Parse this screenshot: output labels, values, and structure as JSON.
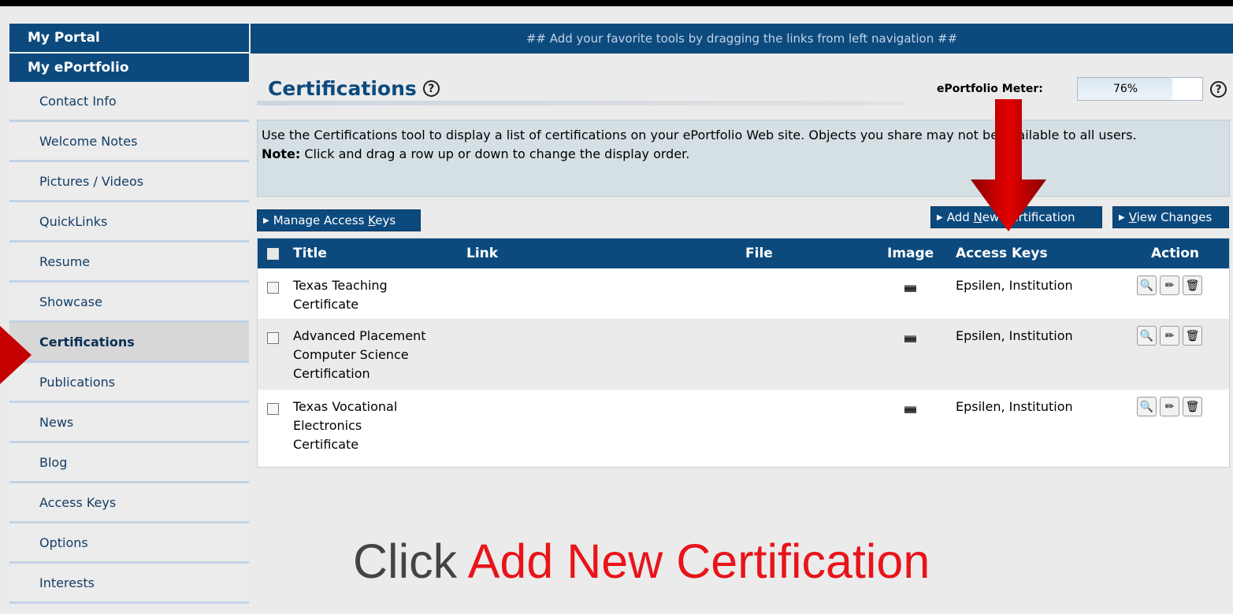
{
  "banner": "## Add your favorite tools by dragging the links from left navigation ##",
  "sidebar": {
    "portal": "My Portal",
    "eportfolio": "My ePortfolio",
    "items": [
      {
        "label": "Contact Info"
      },
      {
        "label": "Welcome Notes"
      },
      {
        "label": "Pictures / Videos"
      },
      {
        "label": "QuickLinks"
      },
      {
        "label": "Resume"
      },
      {
        "label": "Showcase"
      },
      {
        "label": "Certifications",
        "active": true
      },
      {
        "label": "Publications"
      },
      {
        "label": "News"
      },
      {
        "label": "Blog"
      },
      {
        "label": "Access Keys"
      },
      {
        "label": "Options"
      },
      {
        "label": "Interests"
      }
    ]
  },
  "page": {
    "title": "Certifications",
    "help_symbol": "?",
    "meter_label": "ePortfolio Meter:",
    "meter_value": "76%",
    "meter_fraction": 0.76
  },
  "info": {
    "line1": "Use the Certifications tool to display a list of certifications on your ePortfolio Web site. Objects you share may not be available to all users.",
    "note_label": "Note:",
    "note_text": " Click and drag a row up or down to change the display order."
  },
  "buttons": {
    "manage_prefix": "Manage Access ",
    "manage_key": "K",
    "manage_suffix": "eys",
    "add_prefix": "Add ",
    "add_key": "N",
    "add_suffix": "ew Certification",
    "view_key": "V",
    "view_suffix": "iew Changes"
  },
  "table": {
    "columns": [
      "Title",
      "Link",
      "File",
      "Image",
      "Access Keys",
      "Action"
    ],
    "rows": [
      {
        "title": [
          "Texas Teaching",
          "Certificate"
        ],
        "link": "",
        "file": "",
        "access_keys": "Epsilen, Institution"
      },
      {
        "title": [
          "Advanced Placement",
          "Computer Science",
          "Certification"
        ],
        "link": "",
        "file": "",
        "access_keys": "Epsilen, Institution"
      },
      {
        "title": [
          "Texas Vocational",
          "Electronics",
          "Certificate"
        ],
        "link": "",
        "file": "",
        "access_keys": "Epsilen, Institution"
      }
    ]
  },
  "caption": {
    "prefix": "Click ",
    "highlight": "Add New Certification"
  },
  "colors": {
    "brand_blue": "#0c4a7e",
    "highlight_red": "#e8141a",
    "arrow_red": "#cc0000"
  },
  "icons": [
    "help-icon",
    "image-thumbnail-icon",
    "view-magnifier-icon",
    "edit-pencil-icon",
    "delete-bin-icon",
    "triangle-right-icon",
    "arrow-down-icon",
    "arrow-right-icon"
  ]
}
